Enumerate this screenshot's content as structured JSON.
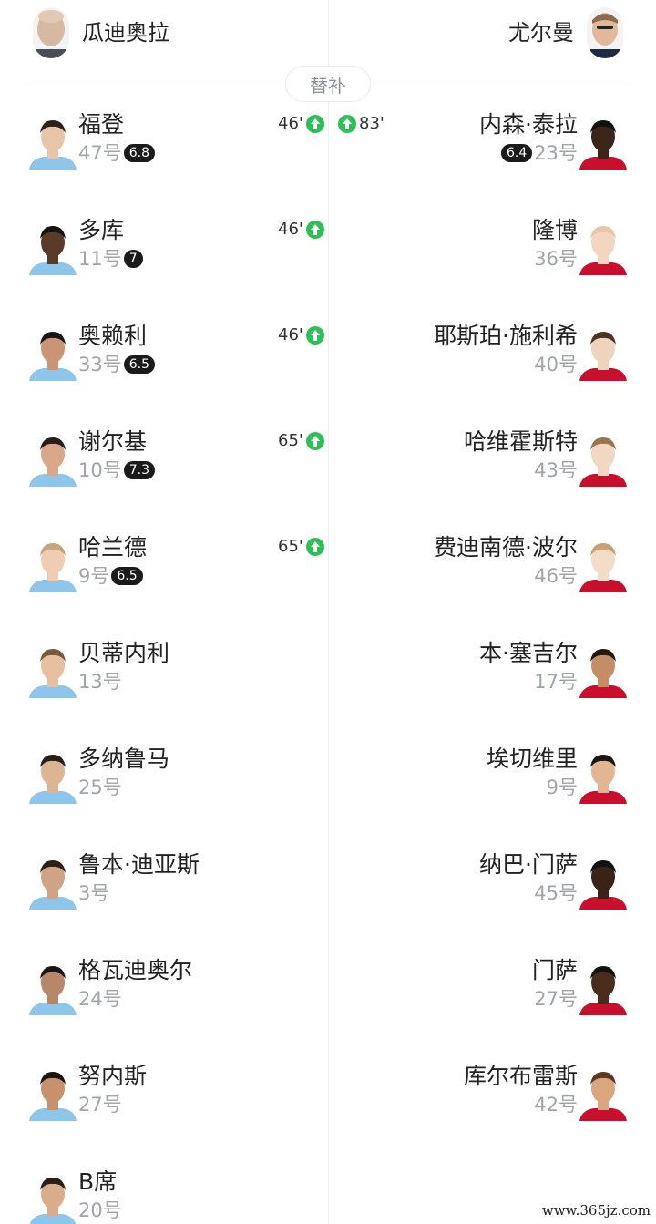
{
  "header": {
    "home_coach": "瓜迪奥拉",
    "away_coach": "尤尔曼",
    "subs_label": "替补"
  },
  "rows": [
    {
      "home": {
        "name": "福登",
        "number": "47号",
        "rating": "6.8",
        "sub_minute": "46'"
      },
      "away": {
        "name": "内森·泰拉",
        "number": "23号",
        "rating": "6.4",
        "sub_minute": "83'"
      }
    },
    {
      "home": {
        "name": "多库",
        "number": "11号",
        "rating": "7",
        "sub_minute": "46'"
      },
      "away": {
        "name": "隆博",
        "number": "36号"
      }
    },
    {
      "home": {
        "name": "奥赖利",
        "number": "33号",
        "rating": "6.5",
        "sub_minute": "46'"
      },
      "away": {
        "name": "耶斯珀·施利希",
        "number": "40号"
      }
    },
    {
      "home": {
        "name": "谢尔基",
        "number": "10号",
        "rating": "7.3",
        "sub_minute": "65'"
      },
      "away": {
        "name": "哈维霍斯特",
        "number": "43号"
      }
    },
    {
      "home": {
        "name": "哈兰德",
        "number": "9号",
        "rating": "6.5",
        "sub_minute": "65'"
      },
      "away": {
        "name": "费迪南德·波尔",
        "number": "46号"
      }
    },
    {
      "home": {
        "name": "贝蒂内利",
        "number": "13号"
      },
      "away": {
        "name": "本·塞吉尔",
        "number": "17号"
      }
    },
    {
      "home": {
        "name": "多纳鲁马",
        "number": "25号"
      },
      "away": {
        "name": "埃切维里",
        "number": "9号"
      }
    },
    {
      "home": {
        "name": "鲁本·迪亚斯",
        "number": "3号"
      },
      "away": {
        "name": "纳巴·门萨",
        "number": "45号"
      }
    },
    {
      "home": {
        "name": "格瓦迪奥尔",
        "number": "24号"
      },
      "away": {
        "name": "门萨",
        "number": "27号"
      }
    },
    {
      "home": {
        "name": "努内斯",
        "number": "27号"
      },
      "away": {
        "name": "库尔布雷斯",
        "number": "42号"
      }
    },
    {
      "home": {
        "name": "B席",
        "number": "20号"
      },
      "away": null
    }
  ],
  "colors": {
    "home_kit": "#8ec5ea",
    "away_kit": "#c8102e",
    "sub_in_arrow": "#2fbf59",
    "rating_badge": "#1a1a1a"
  },
  "icons": {
    "sub_in": "arrow-up-icon"
  },
  "watermark": "www.365jz.com"
}
